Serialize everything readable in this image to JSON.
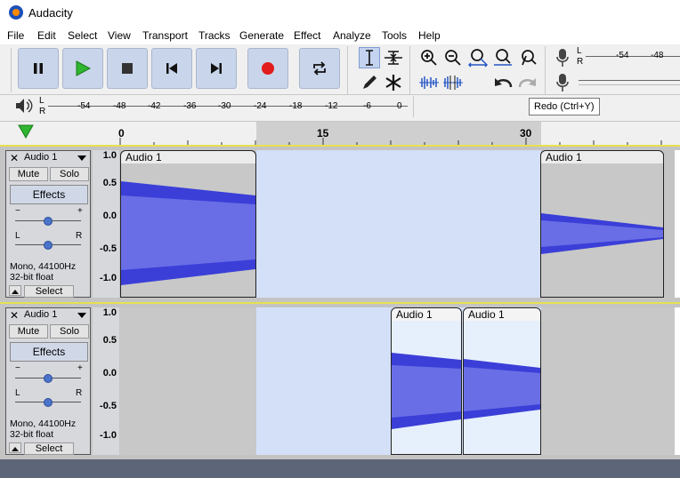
{
  "window": {
    "title": "Audacity"
  },
  "menu": [
    "File",
    "Edit",
    "Select",
    "View",
    "Transport",
    "Tracks",
    "Generate",
    "Effect",
    "Analyze",
    "Tools",
    "Help"
  ],
  "colors": {
    "waveform": "#3b3fd8",
    "waveform_rms": "#6a6ee6",
    "selection_bg": "#d4e0f8",
    "clip_bg": "#c8c8c8",
    "clip_selected_bg": "#e6effc"
  },
  "transport_icons": [
    "pause-icon",
    "play-icon",
    "stop-icon",
    "skip-to-start-icon",
    "skip-to-end-icon",
    "record-icon",
    "loop-icon"
  ],
  "meters": {
    "record_channel_labels": [
      "L",
      "R"
    ],
    "record_ticks": [
      "-54",
      "-48"
    ],
    "playback_channel_labels": [
      "L",
      "R"
    ],
    "playback_ticks": [
      "-54",
      "-48",
      "-42",
      "-36",
      "-30",
      "-24",
      "-18",
      "-12",
      "-6",
      "0"
    ]
  },
  "tooltip": "Redo (Ctrl+Y)",
  "timeline": {
    "labels": [
      "0",
      "15",
      "30"
    ]
  },
  "tracks": [
    {
      "name": "Audio 1",
      "mute": "Mute",
      "solo": "Solo",
      "effects": "Effects",
      "gain_minus": "−",
      "gain_plus": "+",
      "pan_left": "L",
      "pan_right": "R",
      "info_line1": "Mono, 44100Hz",
      "info_line2": "32-bit float",
      "select": "Select",
      "scale": [
        "1.0",
        "0.5",
        "0.0",
        "-0.5",
        "-1.0"
      ],
      "clips": [
        {
          "title": "Audio 1"
        },
        {
          "title": "Audio 1"
        }
      ]
    },
    {
      "name": "Audio 1",
      "mute": "Mute",
      "solo": "Solo",
      "effects": "Effects",
      "gain_minus": "−",
      "gain_plus": "+",
      "pan_left": "L",
      "pan_right": "R",
      "info_line1": "Mono, 44100Hz",
      "info_line2": "32-bit float",
      "select": "Select",
      "scale": [
        "1.0",
        "0.5",
        "0.0",
        "-0.5",
        "-1.0"
      ],
      "clips": [
        {
          "title": "Audio 1"
        },
        {
          "title": "Audio 1"
        }
      ]
    }
  ]
}
